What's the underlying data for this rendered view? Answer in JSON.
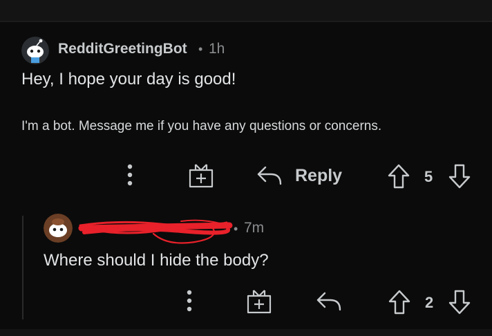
{
  "comment": {
    "username": "RedditGreetingBot",
    "separator": "•",
    "time": "1h",
    "body": "Hey, I hope your day is good!",
    "footer_note": "I'm a bot. Message me if you have any questions or concerns.",
    "actions": {
      "reply_label": "Reply",
      "vote_count": "5"
    },
    "icons": [
      "more-vertical-icon",
      "gift-award-icon",
      "reply-arrow-icon",
      "upvote-icon",
      "downvote-icon"
    ]
  },
  "reply": {
    "username_redacted": true,
    "separator": "•",
    "time": "7m",
    "body": "Where should I hide the body?",
    "actions": {
      "vote_count": "2"
    }
  },
  "colors": {
    "background": "#0b0b0b",
    "text": "#d7dadc",
    "muted": "#8a8c8e",
    "redaction": "#e8212a"
  }
}
